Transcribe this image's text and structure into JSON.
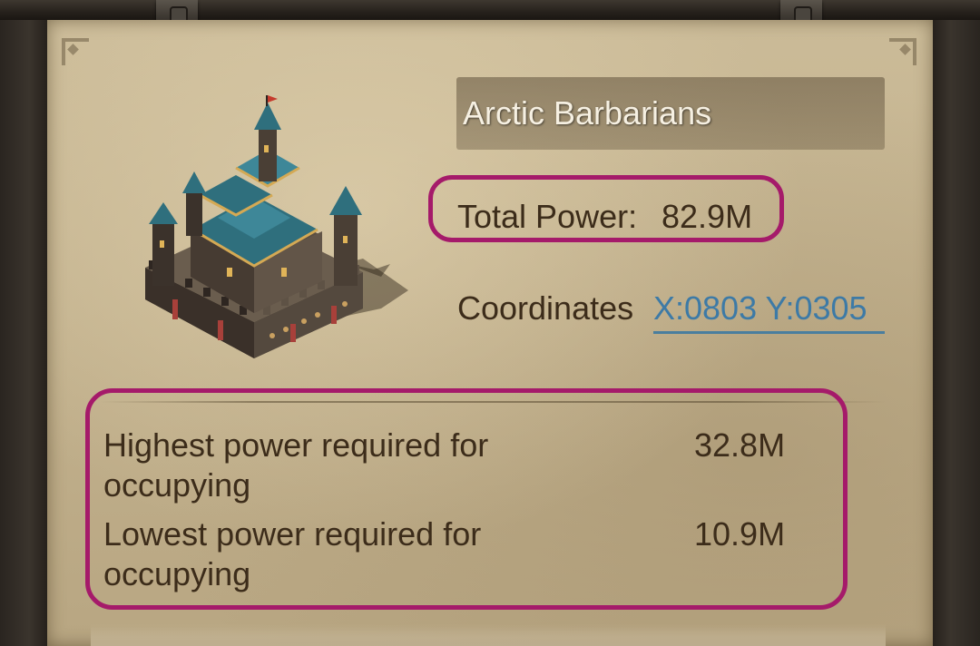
{
  "target": {
    "name": "Arctic Barbarians",
    "total_power_label": "Total Power:",
    "total_power_value": "82.9M",
    "coordinates_label": "Coordinates",
    "coordinates_value": "X:0803 Y:0305"
  },
  "requirements": [
    {
      "label": "Highest power required for occupying",
      "value": "32.8M"
    },
    {
      "label": "Lowest power required for occupying",
      "value": "10.9M"
    }
  ],
  "colors": {
    "highlight_border": "#a51a6a",
    "link": "#3d7aa6",
    "text_dark": "#3c2c1a",
    "title_text": "#f6f0e2"
  },
  "icons": {
    "castle": "castle-icon"
  }
}
